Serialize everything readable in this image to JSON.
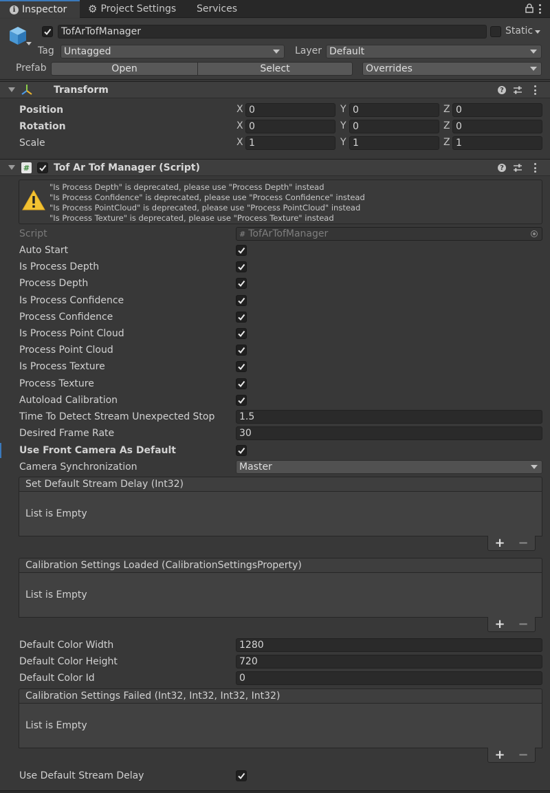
{
  "tabs": [
    {
      "label": "Inspector",
      "icon": "info-icon",
      "active": true
    },
    {
      "label": "Project Settings",
      "icon": "gear-icon",
      "active": false
    },
    {
      "label": "Services",
      "active": false
    }
  ],
  "gameobject": {
    "name": "TofArTofManager",
    "active": true,
    "static_label": "Static",
    "tag_label": "Tag",
    "tag_value": "Untagged",
    "layer_label": "Layer",
    "layer_value": "Default",
    "prefab_label": "Prefab",
    "open_button": "Open",
    "select_button": "Select",
    "overrides_button": "Overrides"
  },
  "transform": {
    "title": "Transform",
    "rows": [
      {
        "label": "Position",
        "bold": true,
        "x": "0",
        "y": "0",
        "z": "0"
      },
      {
        "label": "Rotation",
        "bold": true,
        "x": "0",
        "y": "0",
        "z": "0"
      },
      {
        "label": "Scale",
        "bold": false,
        "x": "1",
        "y": "1",
        "z": "1"
      }
    ],
    "axes": [
      "X",
      "Y",
      "Z"
    ]
  },
  "script_component": {
    "title": "Tof Ar Tof Manager (Script)",
    "enabled": true,
    "warnings": [
      "\"Is Process Depth\" is deprecated, please use \"Process Depth\" instead",
      "\"Is Process Confidence\" is deprecated, please use \"Process Confidence\" instead",
      "\"Is Process PointCloud\" is deprecated, please use \"Process PointCloud\" instead",
      "\"Is Process Texture\" is deprecated, please use \"Process Texture\" instead"
    ],
    "script_label": "Script",
    "script_value": "TofArTofManager",
    "checkbox_rows": [
      {
        "label": "Auto Start",
        "checked": true
      },
      {
        "label": "Is Process Depth",
        "checked": true
      },
      {
        "label": "Process Depth",
        "checked": true
      },
      {
        "label": "Is Process Confidence",
        "checked": true
      },
      {
        "label": "Process Confidence",
        "checked": true
      },
      {
        "label": "Is Process Point Cloud",
        "checked": true
      },
      {
        "label": "Process Point Cloud",
        "checked": true
      },
      {
        "label": "Is Process Texture",
        "checked": true
      },
      {
        "label": "Process Texture",
        "checked": true
      },
      {
        "label": "Autoload Calibration",
        "checked": true
      }
    ],
    "time_to_detect_label": "Time To Detect Stream Unexpected Stop",
    "time_to_detect_value": "1.5",
    "desired_frame_rate_label": "Desired Frame Rate",
    "desired_frame_rate_value": "30",
    "use_front_camera_label": "Use Front Camera As Default",
    "use_front_camera_checked": true,
    "camera_sync_label": "Camera Synchronization",
    "camera_sync_value": "Master",
    "list_set_default_delay": "Set Default Stream Delay (Int32)",
    "list_calibration_loaded": "Calibration Settings Loaded (CalibrationSettingsProperty)",
    "list_calibration_failed": "Calibration Settings Failed (Int32, Int32, Int32, Int32)",
    "list_empty_text": "List is Empty",
    "default_color_width_label": "Default Color Width",
    "default_color_width_value": "1280",
    "default_color_height_label": "Default Color Height",
    "default_color_height_value": "720",
    "default_color_id_label": "Default Color Id",
    "default_color_id_value": "0",
    "use_default_stream_delay_label": "Use Default Stream Delay",
    "use_default_stream_delay_checked": true
  },
  "colors": {
    "accent": "#3a79bb",
    "background": "#383838",
    "field": "#2a2a2a"
  }
}
